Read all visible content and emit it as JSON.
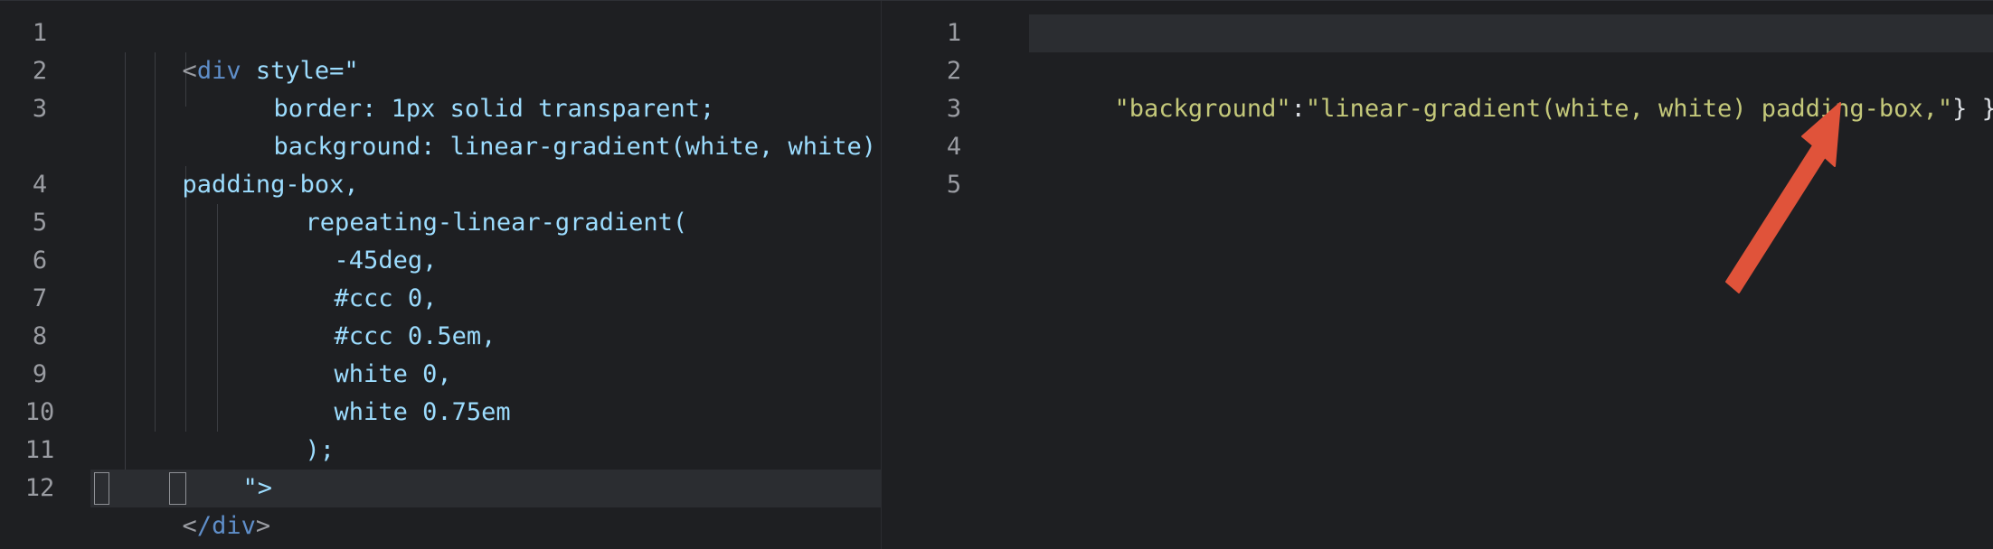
{
  "left_editor": {
    "line_numbers": [
      "1",
      "2",
      "3",
      "",
      "4",
      "5",
      "6",
      "7",
      "8",
      "9",
      "10",
      "11",
      "12"
    ],
    "lines": [
      {
        "parts": [
          "<",
          "div",
          " style=\""
        ]
      },
      {
        "text": "border: 1px solid transparent;"
      },
      {
        "text": "background: linear-gradient(white, white)"
      },
      {
        "text": "padding-box,"
      },
      {
        "text": "repeating-linear-gradient("
      },
      {
        "text": "-45deg,"
      },
      {
        "text": "#ccc 0,"
      },
      {
        "text": "#ccc 0.5em,"
      },
      {
        "text": "white 0,"
      },
      {
        "text": "white 0.75em"
      },
      {
        "text": ");"
      },
      {
        "text": "\">"
      },
      {
        "parts": [
          "<",
          "/div",
          ">"
        ]
      }
    ]
  },
  "right_editor": {
    "line_numbers": [
      "1",
      "2",
      "3",
      "4",
      "5"
    ],
    "line2": {
      "key": "\"background\"",
      "colon": ":",
      "value": "\"linear-gradient(white, white) padding-box,\"",
      "tail": "} }))"
    }
  },
  "colors": {
    "background": "#1e1f22",
    "tag": "#5f8ec9",
    "css_text": "#9cdcfe",
    "string": "#c4c87a",
    "arrow": "#e0533a"
  },
  "annotation": {
    "arrow_icon": "red-arrow-icon"
  }
}
